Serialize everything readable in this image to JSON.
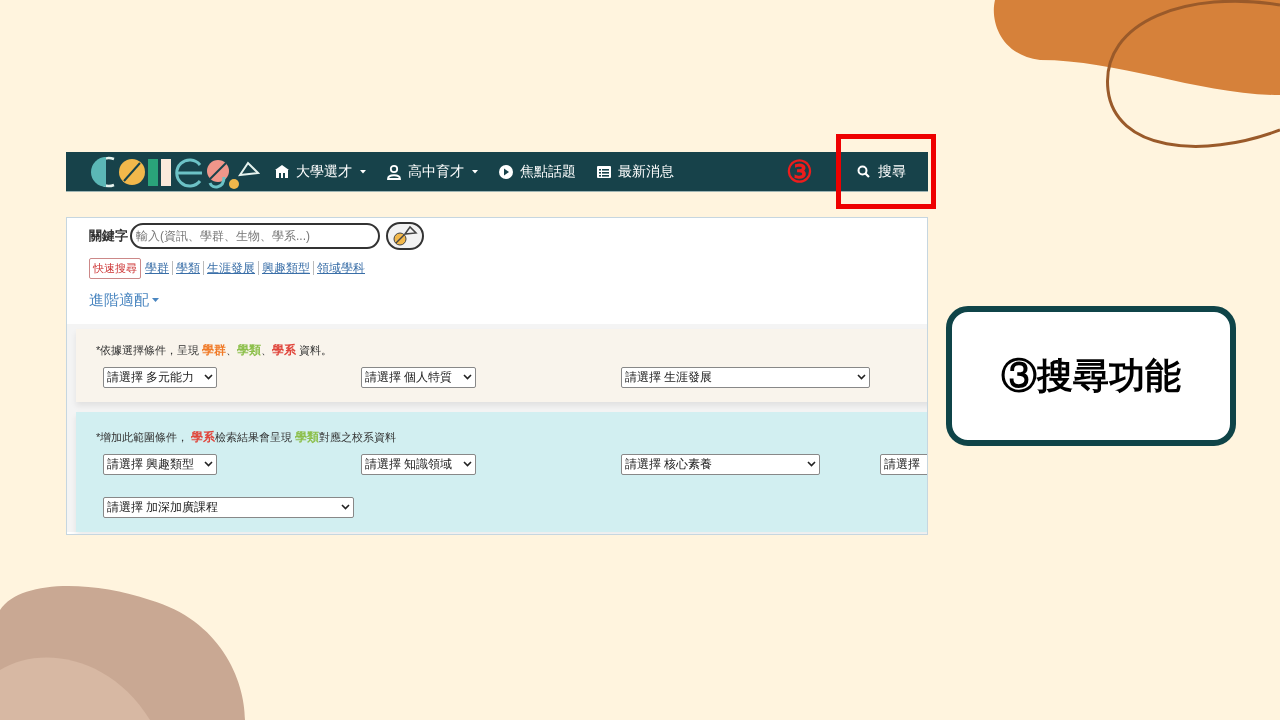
{
  "navbar": {
    "items": [
      {
        "label": "大學選才",
        "dropdown": true
      },
      {
        "label": "高中育才",
        "dropdown": true
      },
      {
        "label": "焦點話題",
        "dropdown": false
      },
      {
        "label": "最新消息",
        "dropdown": false
      }
    ],
    "marker": "③",
    "search": {
      "label": "搜尋",
      "highlighted": true
    }
  },
  "search_panel": {
    "keyword_label": "關鍵字",
    "keyword_placeholder": "輸入(資訊、學群、生物、學系...)",
    "quick_label": "快速搜尋",
    "quick_links": [
      "學群",
      "學類",
      "生涯發展",
      "興趣類型",
      "領域學科"
    ],
    "advanced": "進階適配"
  },
  "filter_sections": [
    {
      "color": "#f9f4ec",
      "note": [
        {
          "text": "*依據選擇條件，呈現 "
        },
        {
          "text": "學群",
          "color": "#f07a28"
        },
        {
          "text": "、"
        },
        {
          "text": "學類",
          "color": "#8cbf4a"
        },
        {
          "text": "、"
        },
        {
          "text": "學系",
          "color": "#e0463c"
        },
        {
          "text": " 資料。"
        }
      ],
      "selects": [
        "請選擇 多元能力",
        "請選擇 個人特質",
        "請選擇 生涯發展"
      ]
    },
    {
      "color": "#d2eff1",
      "note": [
        {
          "text": "*增加此範圍條件， "
        },
        {
          "text": "學系",
          "color": "#e0463c"
        },
        {
          "text": "檢索結果會呈現 "
        },
        {
          "text": "學類",
          "color": "#8cbf4a"
        },
        {
          "text": "對應之校系資料"
        }
      ],
      "selects": [
        "請選擇 興趣類型",
        "請選擇 知識領域",
        "請選擇 核心素養",
        "請選擇",
        "請選擇 加深加廣課程"
      ]
    }
  ],
  "callout": {
    "text": "③搜尋功能"
  }
}
